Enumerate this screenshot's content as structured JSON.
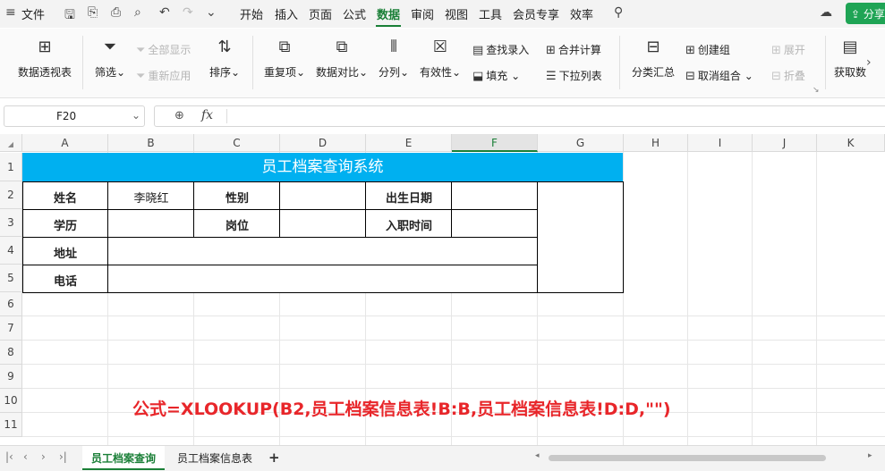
{
  "menubar": {
    "file": "文件",
    "tabs": [
      "开始",
      "插入",
      "页面",
      "公式",
      "数据",
      "审阅",
      "视图",
      "工具",
      "会员专享",
      "效率"
    ],
    "active_tab": "数据",
    "share": "分享"
  },
  "ribbon": {
    "pivot": "数据透视表",
    "filter": "筛选",
    "show_all": "全部显示",
    "reapply": "重新应用",
    "sort": "排序",
    "duplicates": "重复项",
    "compare": "数据对比",
    "split": "分列",
    "validity": "有效性",
    "fill": "填充",
    "lookup_entry": "查找录入",
    "dropdown_list": "下拉列表",
    "consolidate": "合并计算",
    "subtotal": "分类汇总",
    "create_group": "创建组",
    "ungroup": "取消组合",
    "expand": "展开",
    "collapse": "折叠",
    "get_data": "获取数"
  },
  "formula_bar": {
    "name_box": "F20",
    "fx": "fx",
    "formula": ""
  },
  "grid": {
    "columns": [
      "A",
      "B",
      "C",
      "D",
      "E",
      "F",
      "G",
      "H",
      "I",
      "J",
      "K"
    ],
    "selected_column": "F",
    "rows": [
      "1",
      "2",
      "3",
      "4",
      "5",
      "6",
      "7",
      "8",
      "9",
      "10",
      "11"
    ]
  },
  "form": {
    "title": "员工档案查询系统",
    "name_label": "姓名",
    "name_value": "李晓红",
    "gender_label": "性别",
    "birth_label": "出生日期",
    "education_label": "学历",
    "position_label": "岗位",
    "hire_label": "入职时间",
    "address_label": "地址",
    "phone_label": "电话"
  },
  "annotation": "公式=XLOOKUP(B2,员工档案信息表!B:B,员工档案信息表!D:D,\"\")",
  "sheets": {
    "tab1": "员工档案查询",
    "tab2": "员工档案信息表",
    "add": "+"
  },
  "colors": {
    "accent": "#1a7f37",
    "title_bg": "#00b0f0",
    "annotation": "#e8262a"
  }
}
